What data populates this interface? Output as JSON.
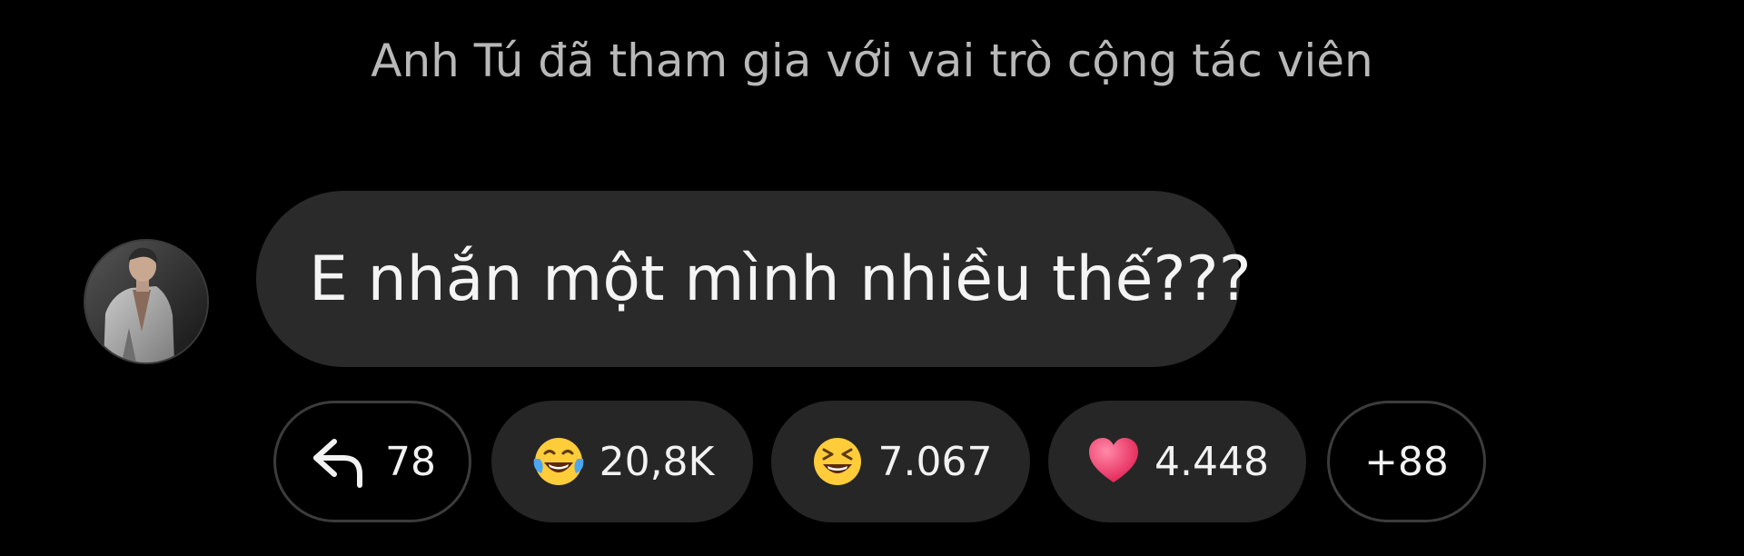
{
  "system_message": "Anh Tú đã tham gia với vai trò cộng tác viên",
  "message": {
    "text": "E nhắn một mình nhiều thế???"
  },
  "actions": {
    "reply": {
      "icon": "reply-arrow-icon",
      "count": "78"
    },
    "reactions": [
      {
        "icon": "tears-of-joy-emoji",
        "count": "20,8K"
      },
      {
        "icon": "laughing-squinting-emoji",
        "count": "7.067"
      },
      {
        "icon": "red-heart-emoji",
        "count": "4.448"
      }
    ],
    "more": "+88"
  },
  "colors": {
    "background": "#000000",
    "bubble": "#2a2a2a",
    "system_text": "#b8b8b8",
    "pill_fill": "#262626",
    "pill_border": "#3c3c3c"
  }
}
